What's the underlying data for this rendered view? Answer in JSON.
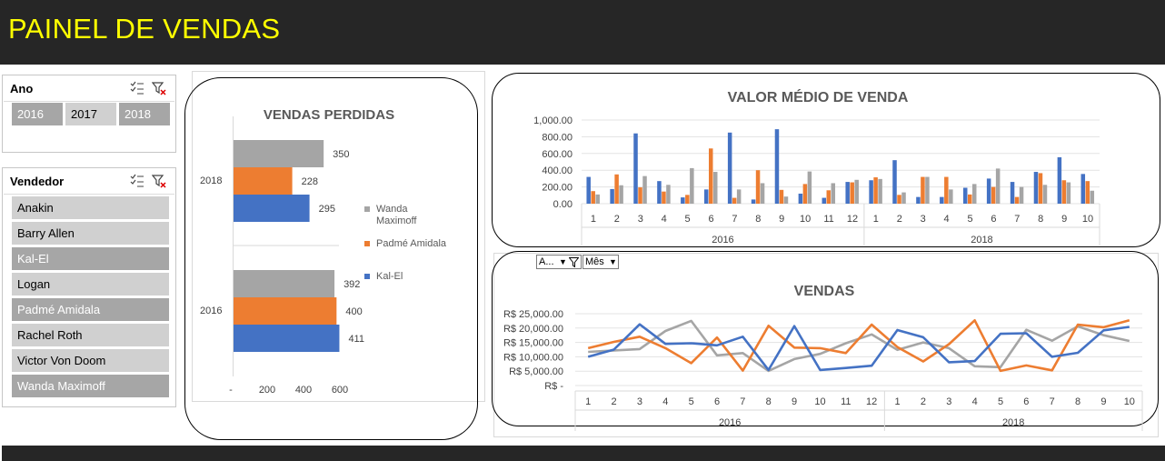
{
  "page_title": "PAINEL DE VENDAS",
  "slicer_ano": {
    "title": "Ano",
    "items": [
      {
        "label": "2016",
        "selected": false
      },
      {
        "label": "2017",
        "selected": true
      },
      {
        "label": "2018",
        "selected": false
      }
    ]
  },
  "slicer_vendedor": {
    "title": "Vendedor",
    "items": [
      {
        "label": "Anakin",
        "selected": true
      },
      {
        "label": "Barry Allen",
        "selected": true
      },
      {
        "label": "Kal-El",
        "selected": false
      },
      {
        "label": "Logan",
        "selected": true
      },
      {
        "label": "Padmé Amidala",
        "selected": false
      },
      {
        "label": "Rachel Roth",
        "selected": true
      },
      {
        "label": "Victor Von Doom",
        "selected": true
      },
      {
        "label": "Wanda Maximoff",
        "selected": false
      }
    ]
  },
  "pivot_filters": {
    "field1": "A...",
    "field2": "Mês"
  },
  "colors": {
    "kal_el": "#4472c4",
    "padme": "#ed7d31",
    "wanda": "#a5a5a5",
    "header_bg": "#262626",
    "title": "#ffff00"
  },
  "chart_data": [
    {
      "type": "bar",
      "orientation": "horizontal",
      "title": "VENDAS PERDIDAS",
      "categories": [
        "2018",
        "2016"
      ],
      "series": [
        {
          "name": "Wanda Maximoff",
          "values": [
            350,
            392
          ]
        },
        {
          "name": "Padmé Amidala",
          "values": [
            228,
            400
          ]
        },
        {
          "name": "Kal-El",
          "values": [
            295,
            411
          ]
        }
      ],
      "xticks": [
        "-",
        "200",
        "400",
        "600"
      ],
      "xlim": [
        0,
        600
      ],
      "legend": "right",
      "grid": false
    },
    {
      "type": "bar",
      "title": "VALOR MÉDIO DE VENDA",
      "groups": [
        {
          "label": "2016",
          "months": [
            "1",
            "2",
            "3",
            "4",
            "5",
            "6",
            "7",
            "8",
            "9",
            "10",
            "11",
            "12"
          ]
        },
        {
          "label": "2018",
          "months": [
            "1",
            "2",
            "3",
            "4",
            "5",
            "6",
            "7",
            "8",
            "9",
            "10"
          ]
        }
      ],
      "series": [
        {
          "color_key": "kal_el",
          "values": [
            320,
            175,
            840,
            270,
            75,
            170,
            850,
            50,
            890,
            120,
            70,
            260,
            280,
            520,
            80,
            80,
            190,
            300,
            260,
            380,
            555,
            355
          ]
        },
        {
          "color_key": "padme",
          "values": [
            150,
            350,
            195,
            145,
            105,
            660,
            70,
            400,
            165,
            235,
            160,
            255,
            315,
            105,
            320,
            320,
            110,
            200,
            80,
            365,
            280,
            270
          ]
        },
        {
          "color_key": "wanda",
          "values": [
            110,
            220,
            330,
            225,
            425,
            380,
            170,
            245,
            85,
            385,
            245,
            285,
            295,
            135,
            320,
            170,
            235,
            420,
            200,
            225,
            255,
            155
          ]
        }
      ],
      "yticks": [
        "1,000.00",
        "800.00",
        "600.00",
        "400.00",
        "200.00",
        "0.00"
      ],
      "ylim": [
        0,
        1000
      ],
      "grid": true
    },
    {
      "type": "line",
      "title": "VENDAS",
      "groups": [
        {
          "label": "2016",
          "months": [
            "1",
            "2",
            "3",
            "4",
            "5",
            "6",
            "7",
            "8",
            "9",
            "10",
            "11",
            "12"
          ]
        },
        {
          "label": "2018",
          "months": [
            "1",
            "2",
            "3",
            "4",
            "5",
            "6",
            "7",
            "8",
            "9",
            "10"
          ]
        }
      ],
      "series": [
        {
          "color_key": "kal_el",
          "values": [
            10000,
            12500,
            21300,
            14500,
            14700,
            14000,
            17000,
            5400,
            20700,
            5400,
            6100,
            6900,
            19300,
            16800,
            8100,
            8500,
            18000,
            18200,
            10000,
            11400,
            19200,
            20400
          ]
        },
        {
          "color_key": "padme",
          "values": [
            13000,
            15200,
            17000,
            13000,
            7800,
            16700,
            5200,
            20800,
            13200,
            13000,
            11300,
            21200,
            13400,
            8400,
            14400,
            22700,
            5100,
            7000,
            5300,
            21200,
            20300,
            22700
          ]
        },
        {
          "color_key": "wanda",
          "values": [
            11700,
            12200,
            12700,
            19000,
            22500,
            10500,
            11300,
            5100,
            9200,
            11000,
            14700,
            17800,
            12400,
            15000,
            13000,
            6700,
            6400,
            19400,
            15600,
            20600,
            17500,
            15500
          ]
        }
      ],
      "yticks": [
        "R$ 25,000.00",
        "R$ 20,000.00",
        "R$ 15,000.00",
        "R$ 10,000.00",
        "R$ 5,000.00",
        "R$ -"
      ],
      "ylim": [
        0,
        25000
      ],
      "grid": true
    }
  ]
}
